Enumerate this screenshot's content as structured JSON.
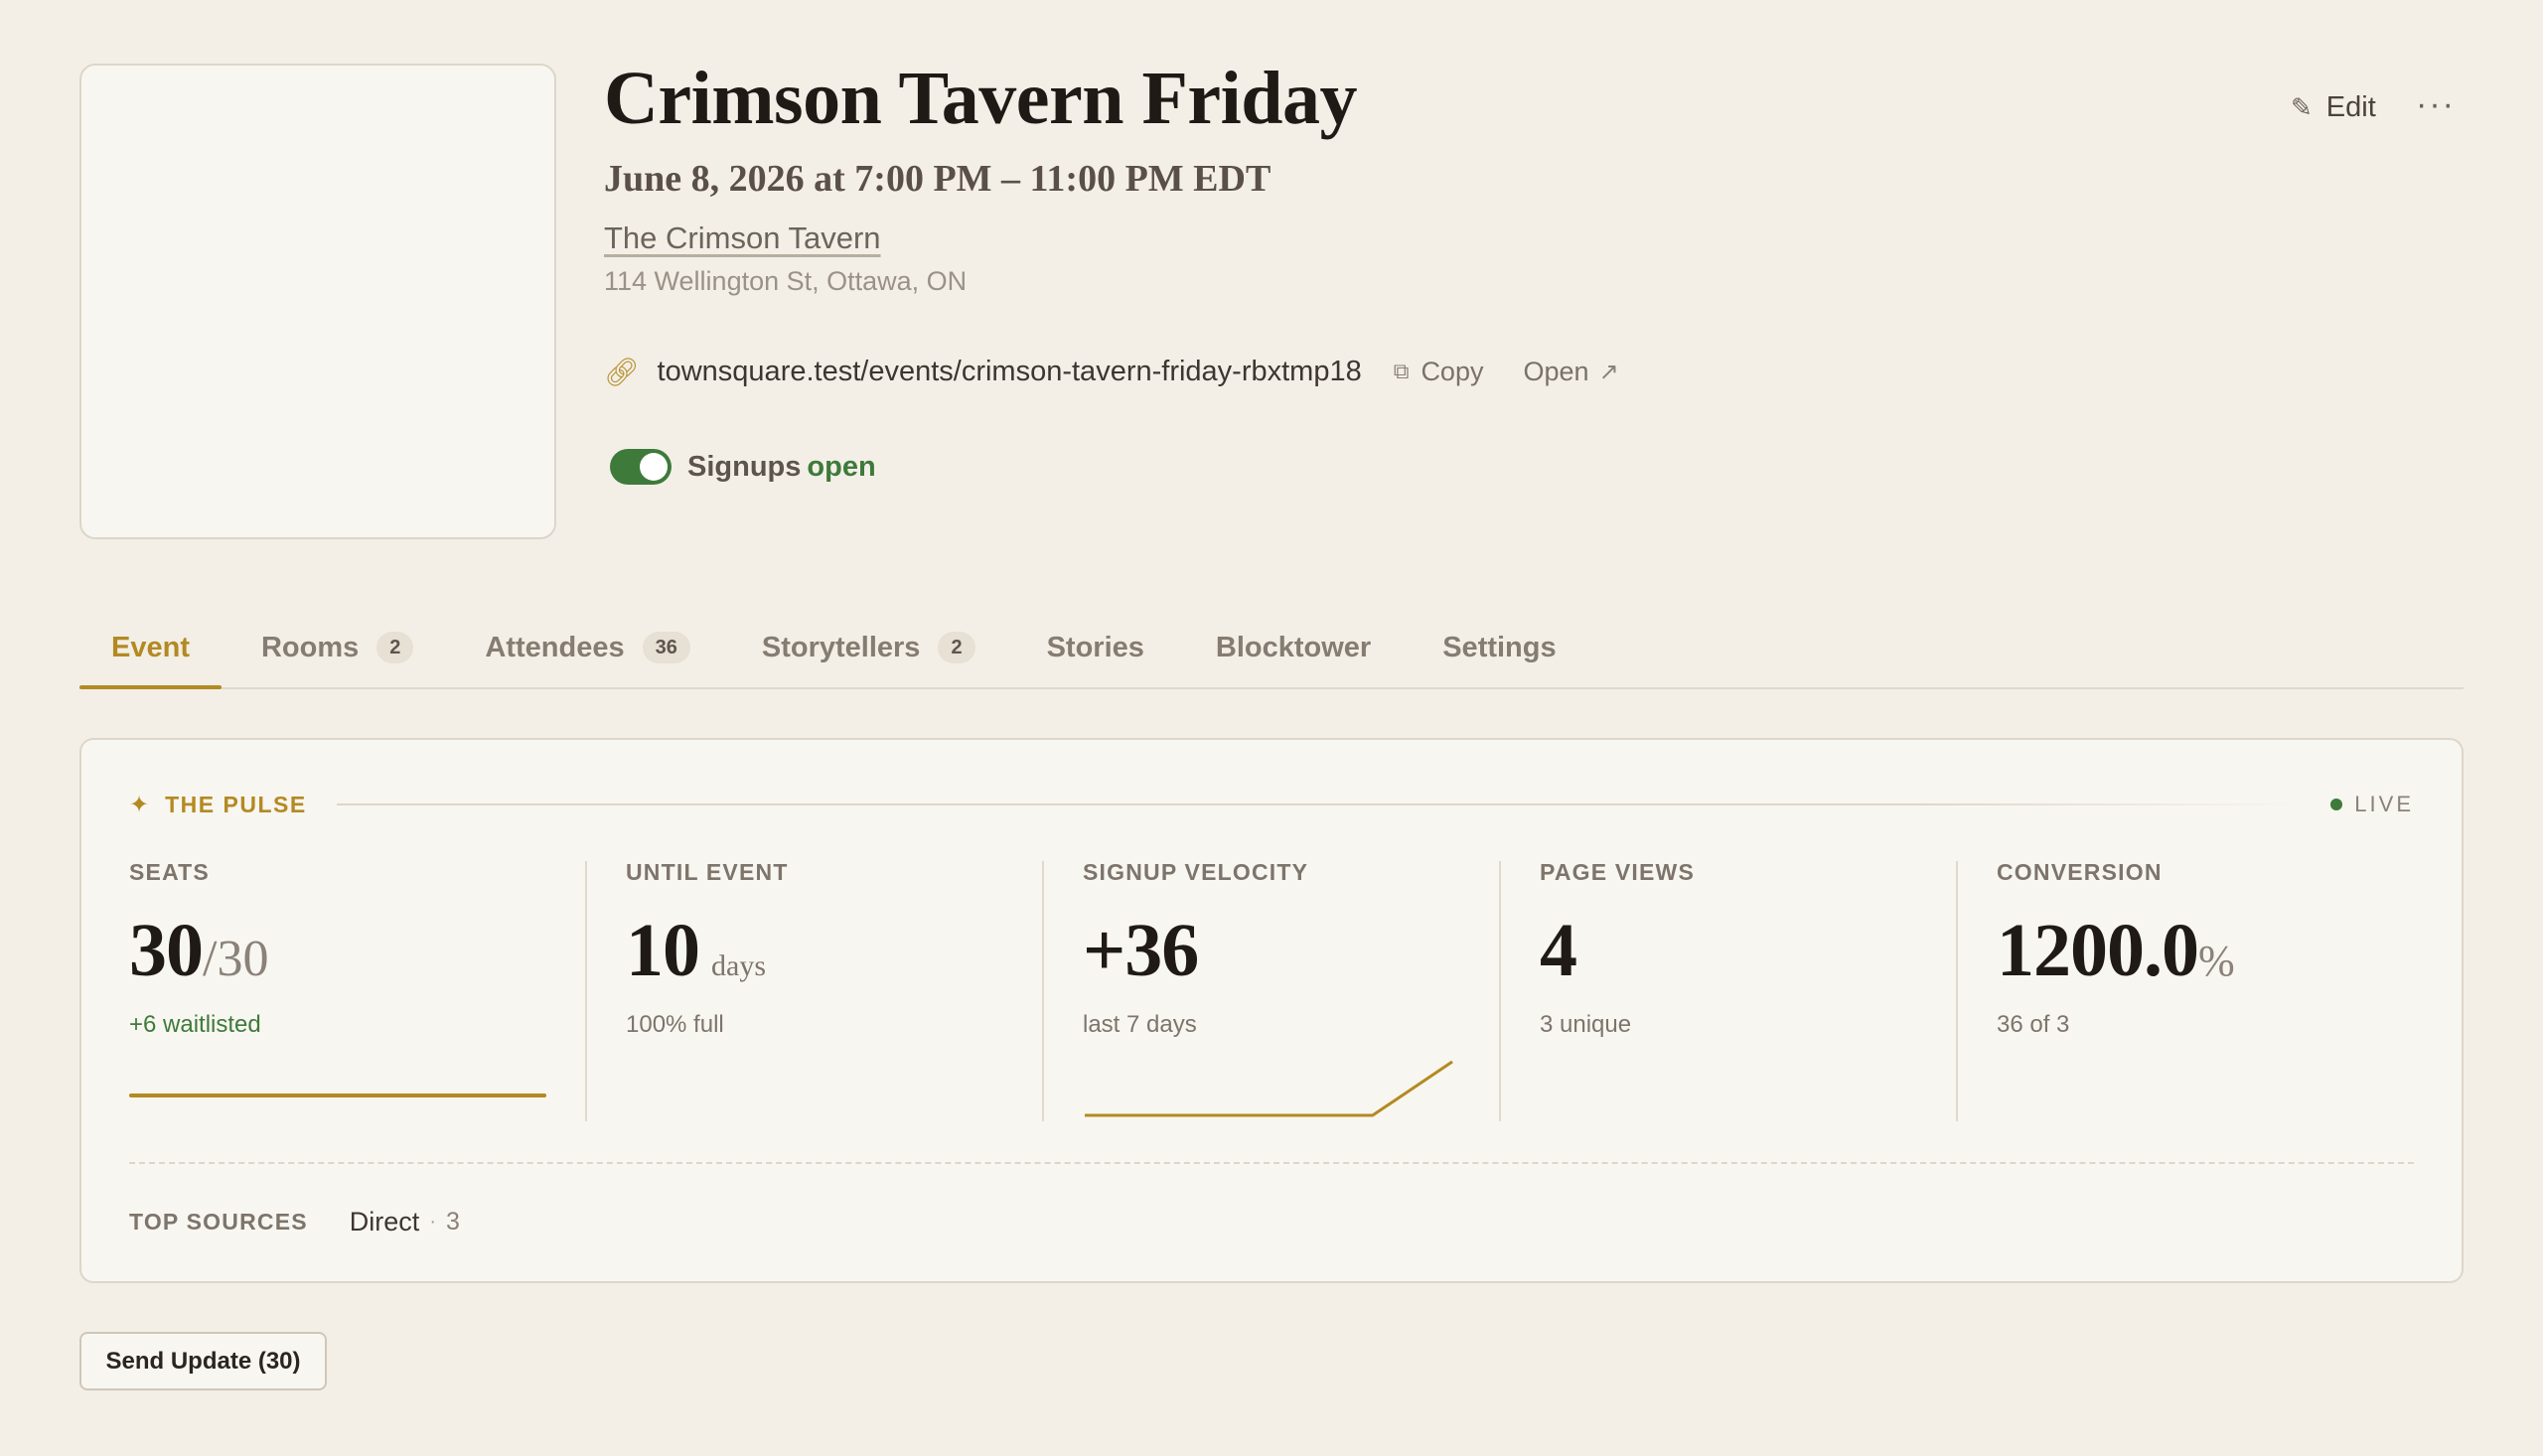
{
  "event": {
    "title": "Crimson Tavern Friday",
    "datetime": "June 8, 2026 at 7:00 PM – 11:00 PM EDT",
    "venue": "The Crimson Tavern",
    "address": "114 Wellington St, Ottawa, ON"
  },
  "link": {
    "url": "townsquare.test/events/crimson-tavern-friday-rbxtmp18",
    "copy_label": "Copy",
    "open_label": "Open"
  },
  "signups": {
    "label": "Signups",
    "state": "open",
    "enabled": true
  },
  "header_actions": {
    "edit_label": "Edit",
    "more_label": "···"
  },
  "tabs": [
    {
      "label": "Event",
      "badge": null,
      "active": true
    },
    {
      "label": "Rooms",
      "badge": "2"
    },
    {
      "label": "Attendees",
      "badge": "36"
    },
    {
      "label": "Storytellers",
      "badge": "2"
    },
    {
      "label": "Stories",
      "badge": null
    },
    {
      "label": "Blocktower",
      "badge": null
    },
    {
      "label": "Settings",
      "badge": null
    }
  ],
  "pulse": {
    "title": "THE PULSE",
    "live_label": "LIVE",
    "metrics": {
      "seats": {
        "label": "SEATS",
        "value": "30",
        "total": "/30",
        "sub": "+6 waitlisted",
        "fill_fraction": 1.0
      },
      "until": {
        "label": "UNTIL EVENT",
        "value": "10",
        "unit": "days",
        "sub": "100% full"
      },
      "velocity": {
        "label": "SIGNUP VELOCITY",
        "value": "+36",
        "sub": "last 7 days",
        "sparkline": [
          0,
          0,
          0,
          0,
          0,
          0,
          36
        ]
      },
      "views": {
        "label": "PAGE VIEWS",
        "value": "4",
        "sub": "3 unique"
      },
      "conversion": {
        "label": "CONVERSION",
        "value": "1200.0",
        "unit": "%",
        "sub": "36 of 3"
      }
    },
    "sources": {
      "label": "TOP SOURCES",
      "items": [
        {
          "name": "Direct",
          "count": "3"
        }
      ]
    }
  },
  "send_update_label": "Send Update (30)",
  "colors": {
    "accent": "#b38a22",
    "live": "#3e7a3a",
    "background": "#f3efe7"
  }
}
